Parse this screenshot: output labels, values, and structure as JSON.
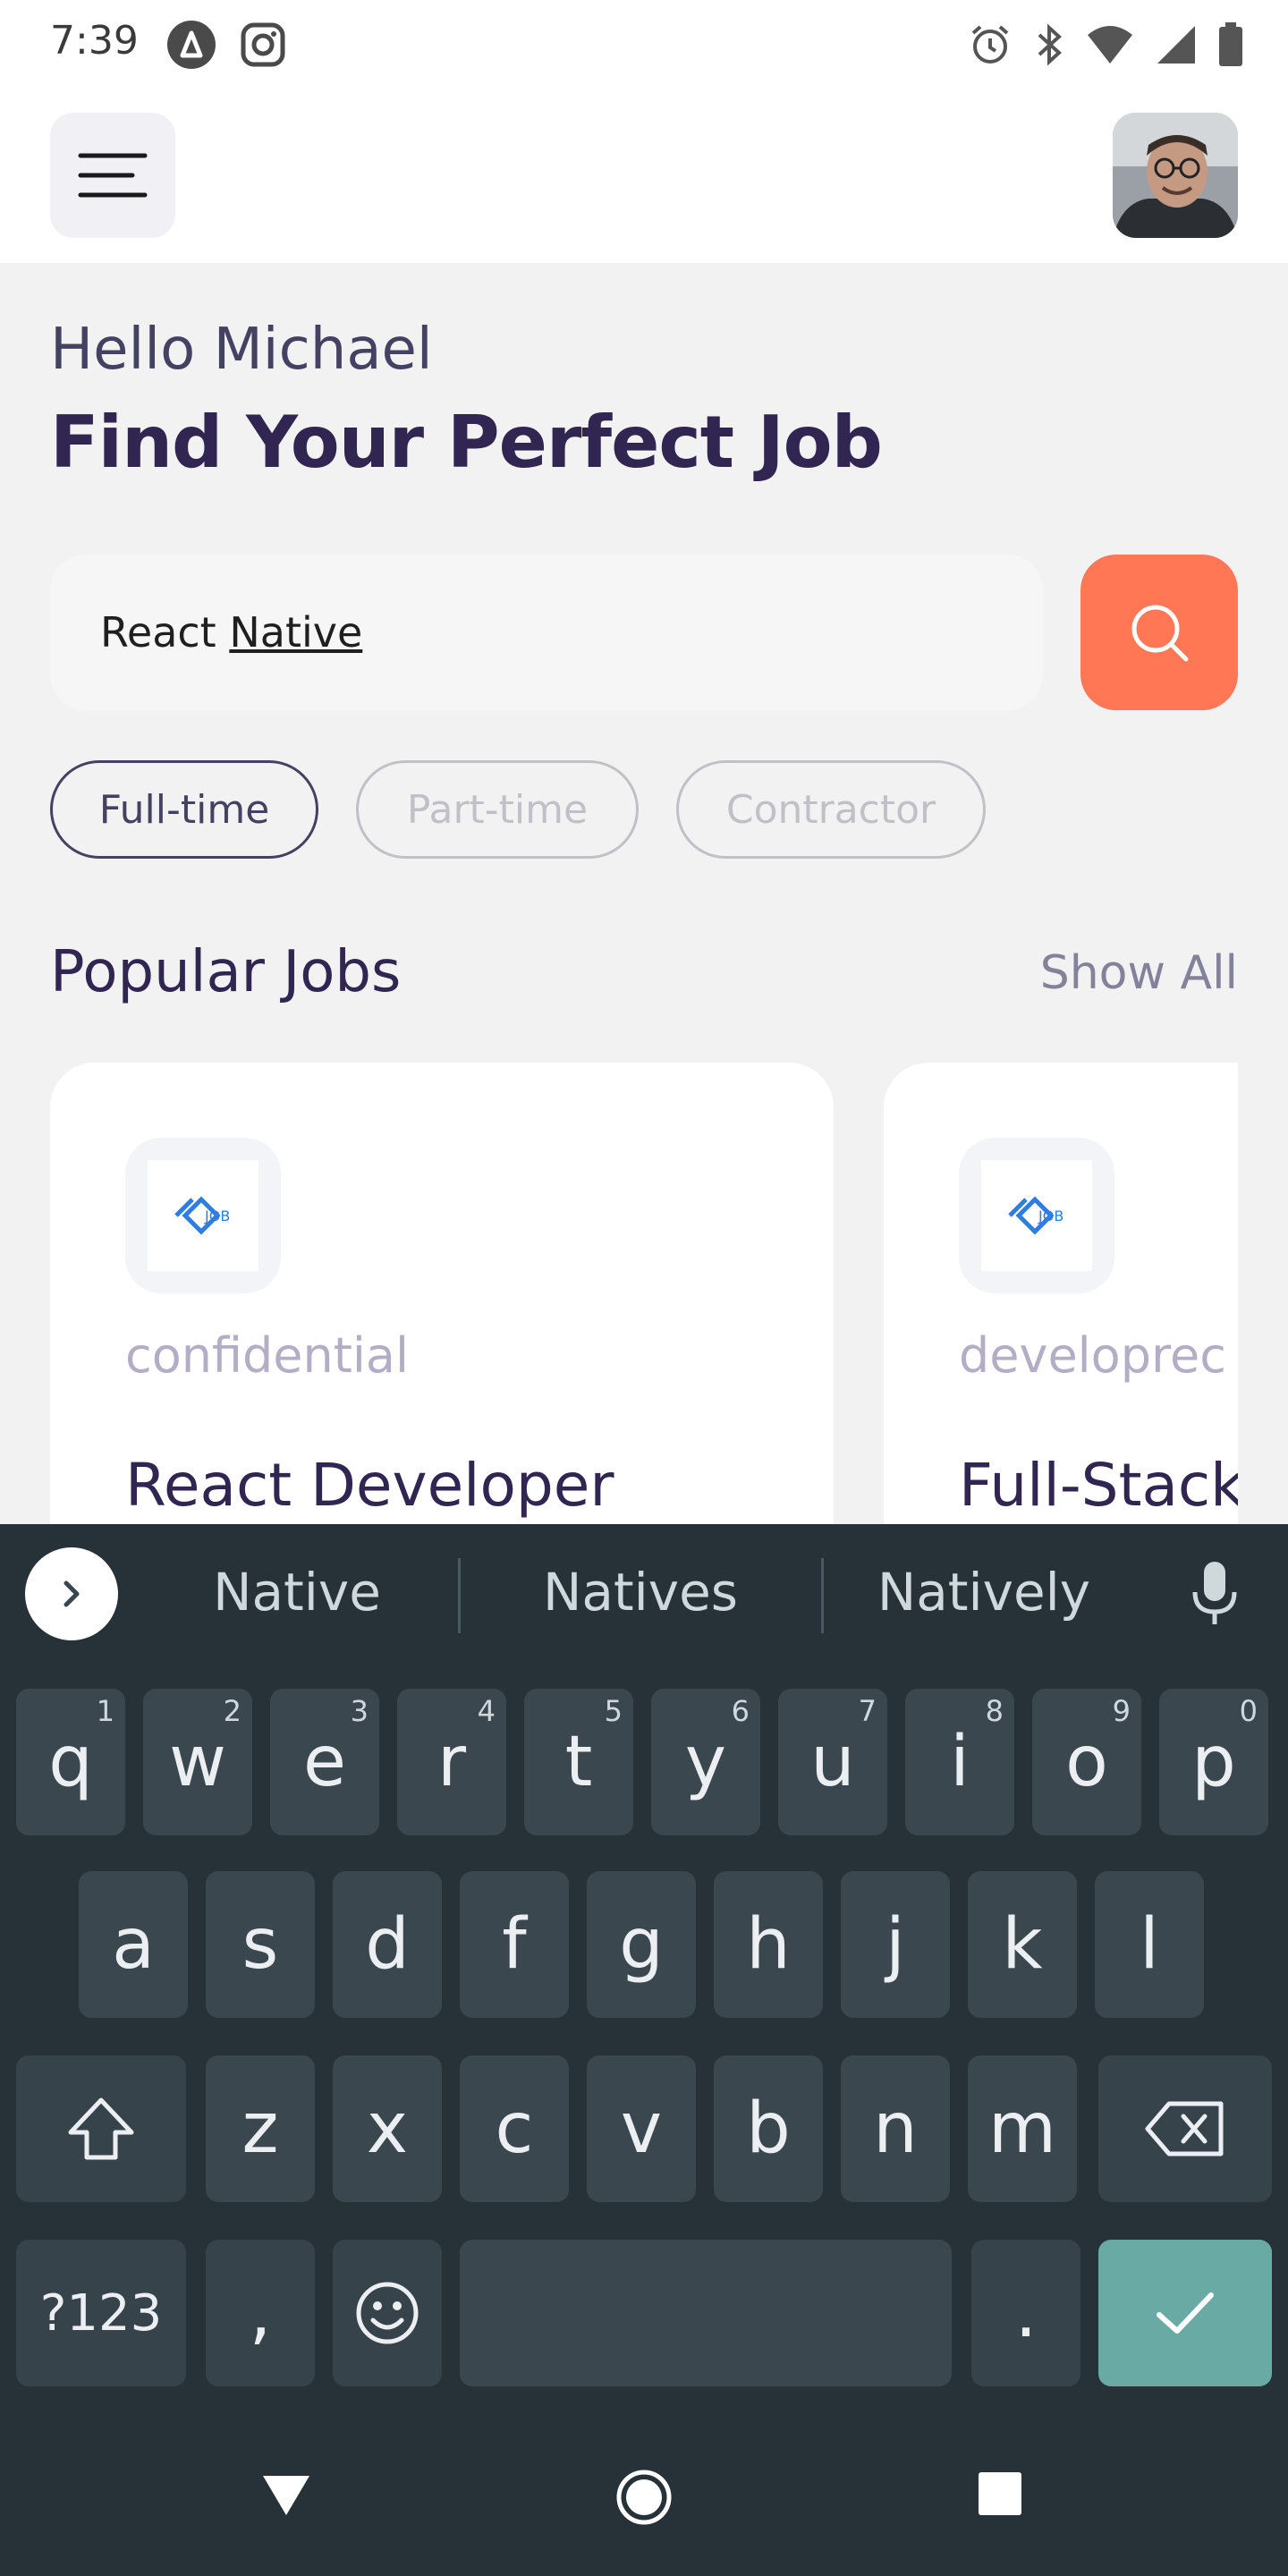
{
  "status_bar": {
    "time": "7:39",
    "icons": [
      "app-a-icon",
      "instagram-icon",
      "alarm-icon",
      "bluetooth-icon",
      "wifi-icon",
      "signal-icon",
      "battery-icon"
    ]
  },
  "header": {
    "menu_icon": "hamburger-menu-icon",
    "avatar": "user-avatar"
  },
  "greeting": "Hello Michael",
  "title": "Find Your Perfect Job",
  "search": {
    "value_part1": "React ",
    "value_part2": "Native",
    "button_icon": "search-icon"
  },
  "job_types": [
    {
      "label": "Full-time",
      "active": true
    },
    {
      "label": "Part-time",
      "active": false
    },
    {
      "label": "Contractor",
      "active": false
    }
  ],
  "section": {
    "title": "Popular Jobs",
    "show_all": "Show All"
  },
  "cards": [
    {
      "company": "confidential",
      "title": "React Developer",
      "logo_text": "JOB"
    },
    {
      "company": "developrec",
      "title": "Full-Stack",
      "logo_text": "JOB"
    }
  ],
  "keyboard": {
    "suggestions": [
      "Native",
      "Natives",
      "Natively"
    ],
    "row1": [
      "q",
      "w",
      "e",
      "r",
      "t",
      "y",
      "u",
      "i",
      "o",
      "p"
    ],
    "row1_nums": [
      "1",
      "2",
      "3",
      "4",
      "5",
      "6",
      "7",
      "8",
      "9",
      "0"
    ],
    "row2": [
      "a",
      "s",
      "d",
      "f",
      "g",
      "h",
      "j",
      "k",
      "l"
    ],
    "row3": [
      "z",
      "x",
      "c",
      "v",
      "b",
      "n",
      "m"
    ],
    "symbols_label": "?123",
    "comma": ",",
    "period": "."
  },
  "colors": {
    "accent": "#ff7754",
    "primary": "#312651",
    "keyboard_bg": "#263238",
    "enter_key": "#6aaaa4"
  }
}
